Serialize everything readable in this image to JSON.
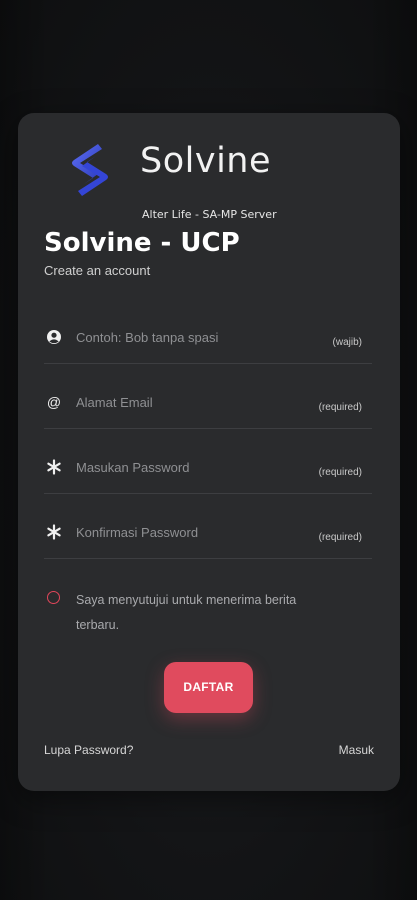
{
  "brand": {
    "name": "Solvine",
    "tagline": "Alter Life - SA-MP Server",
    "logo_colors": [
      "#4b5ce8",
      "#2a39b8"
    ]
  },
  "heading": {
    "title": "Solvine - UCP",
    "subtitle": "Create an account"
  },
  "form": {
    "fields": [
      {
        "icon": "user-icon",
        "placeholder": "Contoh: Bob tanpa spasi",
        "value": "",
        "hint": "(wajib)"
      },
      {
        "icon": "at-icon",
        "placeholder": "Alamat Email",
        "value": "",
        "hint": "(required)"
      },
      {
        "icon": "asterisk-icon",
        "placeholder": "Masukan Password",
        "value": "",
        "hint": "(required)"
      },
      {
        "icon": "asterisk-icon",
        "placeholder": "Konfirmasi Password",
        "value": "",
        "hint": "(required)"
      }
    ],
    "agree_text": "Saya menyutujui untuk menerima berita terbaru.",
    "agree_checked": false,
    "submit_label": "DAFTAR"
  },
  "footer": {
    "forgot_label": "Lupa Password?",
    "login_label": "Masuk"
  },
  "colors": {
    "accent": "#e04b5e",
    "card": "#2a2b2d",
    "background": "#141517"
  }
}
